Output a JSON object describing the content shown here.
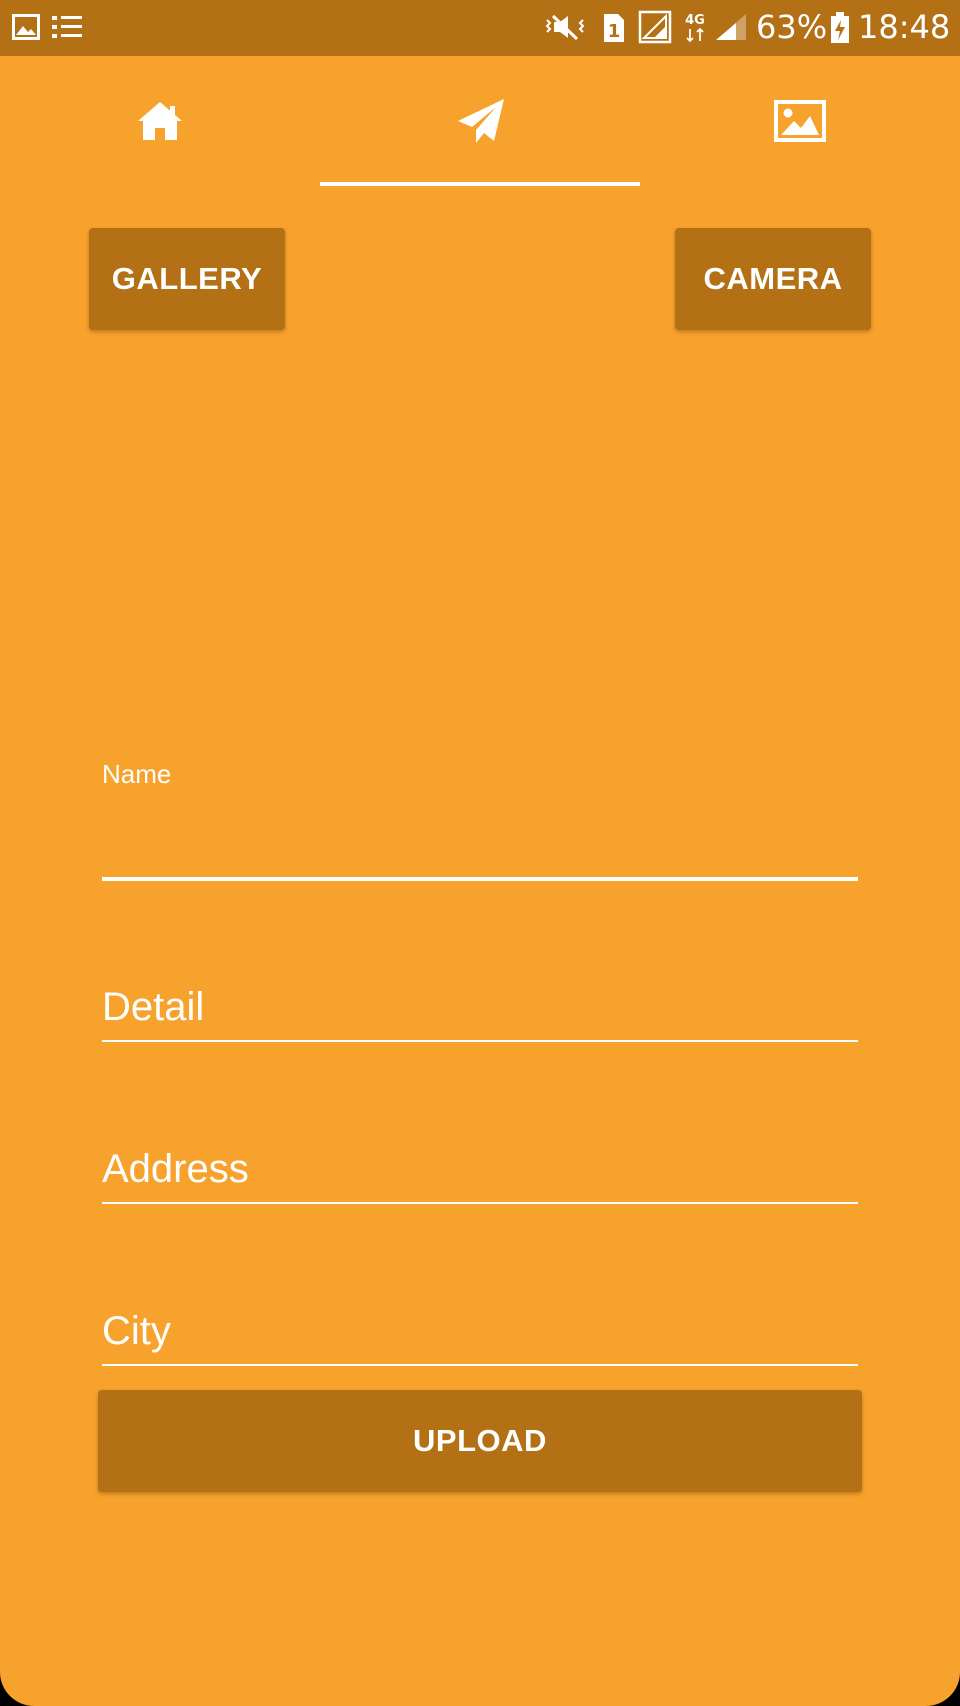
{
  "status_bar": {
    "battery_percent": "63%",
    "time": "18:48",
    "sim_label": "1",
    "network_type": "4G",
    "icons": [
      "image-icon",
      "list-icon",
      "mute-vibrate-icon",
      "sim-icon",
      "signal-icon",
      "4g-icon",
      "signal-icon",
      "battery-charging-icon"
    ]
  },
  "tabs": [
    {
      "name": "home",
      "icon": "home-icon",
      "selected": false
    },
    {
      "name": "send",
      "icon": "paper-plane-icon",
      "selected": true
    },
    {
      "name": "gallery",
      "icon": "image-icon",
      "selected": false
    }
  ],
  "buttons": {
    "gallery": "GALLERY",
    "camera": "CAMERA",
    "upload": "UPLOAD"
  },
  "form": {
    "name": {
      "label": "Name",
      "value": ""
    },
    "detail": {
      "placeholder": "Detail"
    },
    "address": {
      "placeholder": "Address"
    },
    "city": {
      "placeholder": "City"
    }
  },
  "colors": {
    "background": "#F7A22C",
    "status_bar": "#B37015",
    "button": "#B37015",
    "text": "#FFFFFF"
  }
}
